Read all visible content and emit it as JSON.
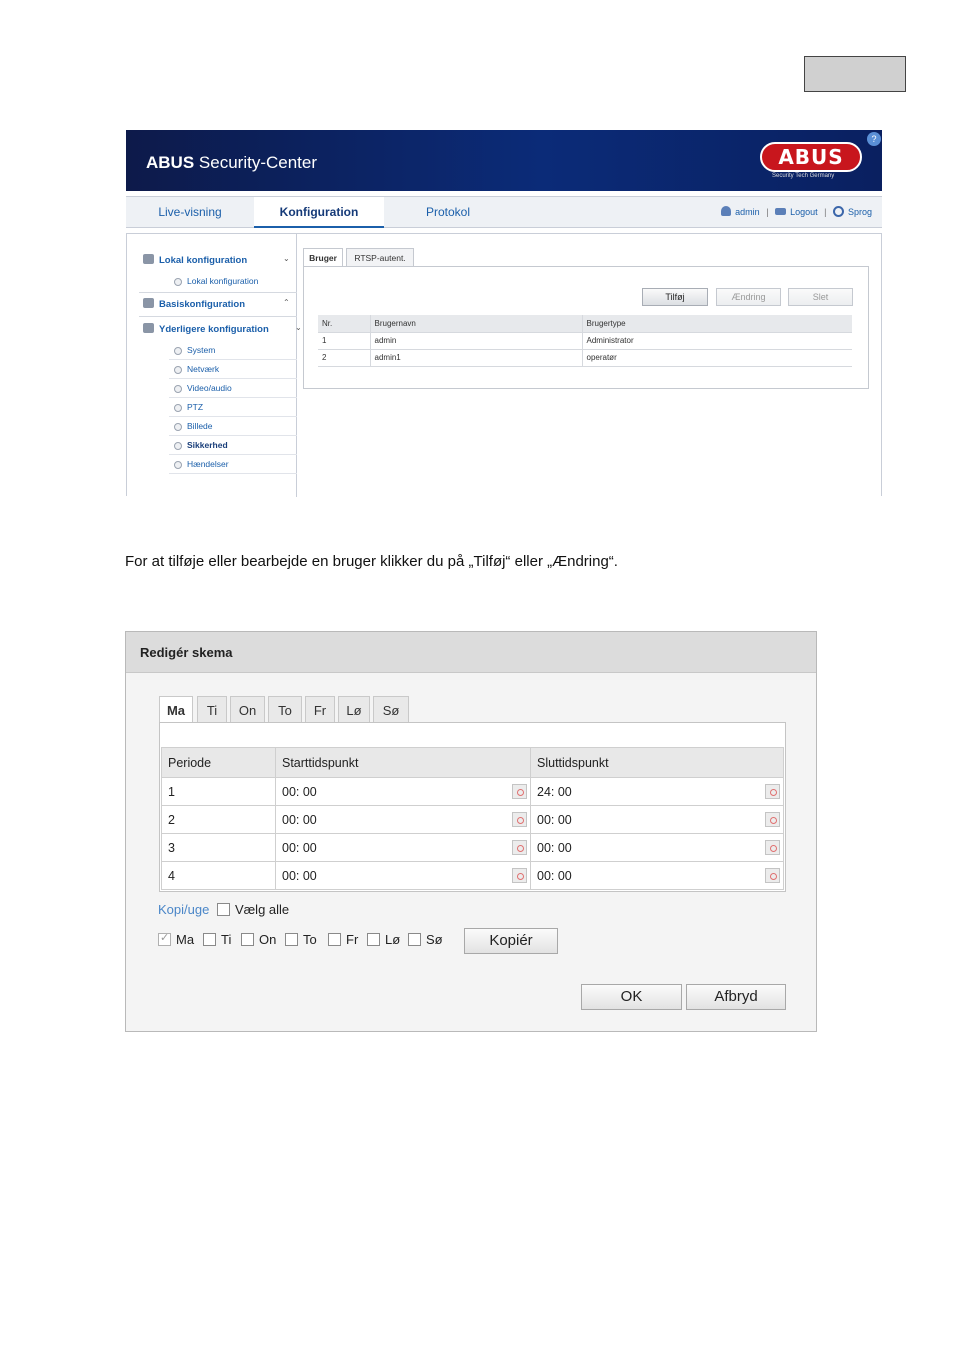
{
  "screenshot1": {
    "header": {
      "brand": "ABUS",
      "title": "Security-Center",
      "logo_text": "ABUS",
      "logo_subtitle": "Security Tech Germany",
      "help_label": "?"
    },
    "nav_tabs": [
      {
        "label": "Live-visning"
      },
      {
        "label": "Konfiguration"
      },
      {
        "label": "Protokol"
      }
    ],
    "nav_right": {
      "user": "admin",
      "logout": "Logout",
      "language": "Sprog"
    },
    "sidebar": {
      "groups": [
        {
          "label": "Lokal konfiguration",
          "items": [
            "Lokal konfiguration"
          ]
        },
        {
          "label": "Basiskonfiguration",
          "items": []
        },
        {
          "label": "Yderligere konfiguration",
          "items": [
            "System",
            "Netværk",
            "Video/audio",
            "PTZ",
            "Billede",
            "Sikkerhed",
            "Hændelser"
          ]
        }
      ],
      "active_item": "Sikkerhed"
    },
    "tabs": [
      {
        "label": "Bruger"
      },
      {
        "label": "RTSP-autent."
      }
    ],
    "buttons": {
      "add": "Tilføj",
      "edit": "Ændring",
      "delete": "Slet"
    },
    "user_table": {
      "headers": [
        "Nr.",
        "Brugernavn",
        "Brugertype"
      ],
      "rows": [
        [
          "1",
          "admin",
          "Administrator"
        ],
        [
          "2",
          "admin1",
          "operatør"
        ]
      ]
    }
  },
  "body_text": "For at tilføje eller bearbejde en bruger klikker du på „Tilføj“ eller „Ændring“.",
  "screenshot2": {
    "dialog_title": "Redigér skema",
    "day_tabs": [
      "Ma",
      "Ti",
      "On",
      "To",
      "Fr",
      "Lø",
      "Sø"
    ],
    "active_day": "Ma",
    "schedule_table": {
      "headers": [
        "Periode",
        "Starttidspunkt",
        "Sluttidspunkt"
      ],
      "rows": [
        [
          "1",
          "00: 00",
          "24: 00"
        ],
        [
          "2",
          "00: 00",
          "00: 00"
        ],
        [
          "3",
          "00: 00",
          "00: 00"
        ],
        [
          "4",
          "00: 00",
          "00: 00"
        ]
      ]
    },
    "copy": {
      "link": "Kopi/uge",
      "select_all": "Vælg alle",
      "button": "Kopiér"
    },
    "copy_days": [
      {
        "label": "Ma",
        "checked": true
      },
      {
        "label": "Ti",
        "checked": false
      },
      {
        "label": "On",
        "checked": false
      },
      {
        "label": "To",
        "checked": false
      },
      {
        "label": "Fr",
        "checked": false
      },
      {
        "label": "Lø",
        "checked": false
      },
      {
        "label": "Sø",
        "checked": false
      }
    ],
    "buttons": {
      "ok": "OK",
      "cancel": "Afbryd"
    }
  }
}
